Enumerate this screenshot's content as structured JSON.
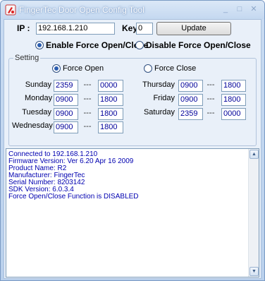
{
  "window": {
    "title": "FingerTec Door Open Config Tool",
    "minimize": "_",
    "maximize": "□",
    "close": "✕"
  },
  "connection": {
    "ip_label": "IP :",
    "ip_value": "192.168.1.210",
    "key_label": "Key",
    "key_value": "0",
    "update_label": "Update"
  },
  "mode": {
    "enable_label": "Enable Force Open/Close",
    "disable_label": "Disable Force Open/Close",
    "selected": "enable"
  },
  "setting": {
    "group_label": "Setting",
    "force_open_label": "Force Open",
    "force_close_label": "Force Close",
    "selected": "force_open",
    "separator": "---",
    "days_left": [
      {
        "day": "Sunday",
        "start": "2359",
        "end": "0000"
      },
      {
        "day": "Monday",
        "start": "0900",
        "end": "1800"
      },
      {
        "day": "Tuesday",
        "start": "0900",
        "end": "1800"
      },
      {
        "day": "Wednesday",
        "start": "0900",
        "end": "1800"
      }
    ],
    "days_right": [
      {
        "day": "Thursday",
        "start": "0900",
        "end": "1800"
      },
      {
        "day": "Friday",
        "start": "0900",
        "end": "1800"
      },
      {
        "day": "Saturday",
        "start": "2359",
        "end": "0000"
      }
    ]
  },
  "log": {
    "lines": [
      "Connected to 192.168.1.210",
      "Firmware Version: Ver 6.20 Apr 16 2009",
      "Product Name: R2",
      "Manufacturer: FingerTec",
      "Serial Number: 8203142",
      "SDK Version: 6.0.3.4",
      "Force Open/Close Function is DISABLED"
    ]
  },
  "colors": {
    "log_text": "#0000b0",
    "field_text": "#00009a",
    "radio_selected": "#2a5db0"
  }
}
